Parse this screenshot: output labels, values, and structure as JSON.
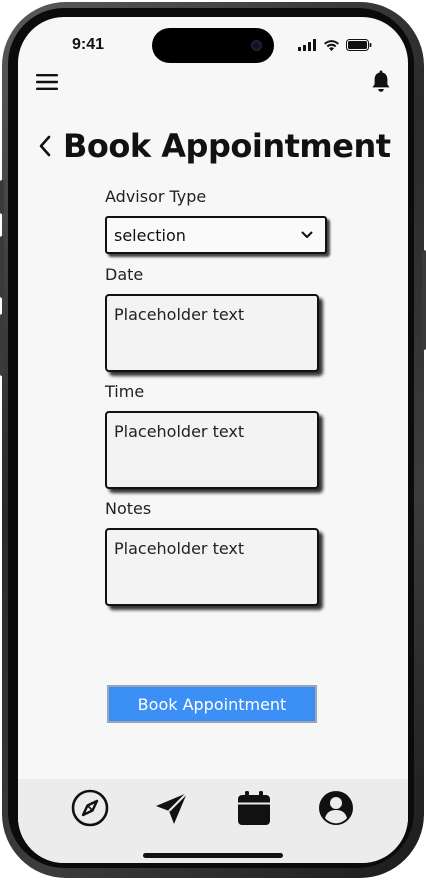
{
  "status_bar": {
    "time": "9:41",
    "icons": [
      "cellular-signal-icon",
      "wifi-icon",
      "battery-icon"
    ]
  },
  "header": {
    "menu_icon": "hamburger-menu-icon",
    "notification_icon": "bell-icon",
    "back_icon": "chevron-left-icon",
    "title": "Book Appointment"
  },
  "form": {
    "advisor_type": {
      "label": "Advisor Type",
      "selected_value": "selection"
    },
    "date": {
      "label": "Date",
      "placeholder": "Placeholder text"
    },
    "time": {
      "label": "Time",
      "placeholder": "Placeholder text"
    },
    "notes": {
      "label": "Notes",
      "placeholder": "Placeholder text"
    },
    "submit_label": "Book Appointment"
  },
  "bottom_nav": {
    "items": [
      {
        "icon": "compass-icon"
      },
      {
        "icon": "send-icon"
      },
      {
        "icon": "calendar-icon"
      },
      {
        "icon": "profile-icon"
      }
    ]
  },
  "colors": {
    "accent": "#3b8ff5",
    "screen_background": "#f7f7f7",
    "text": "#111111"
  }
}
